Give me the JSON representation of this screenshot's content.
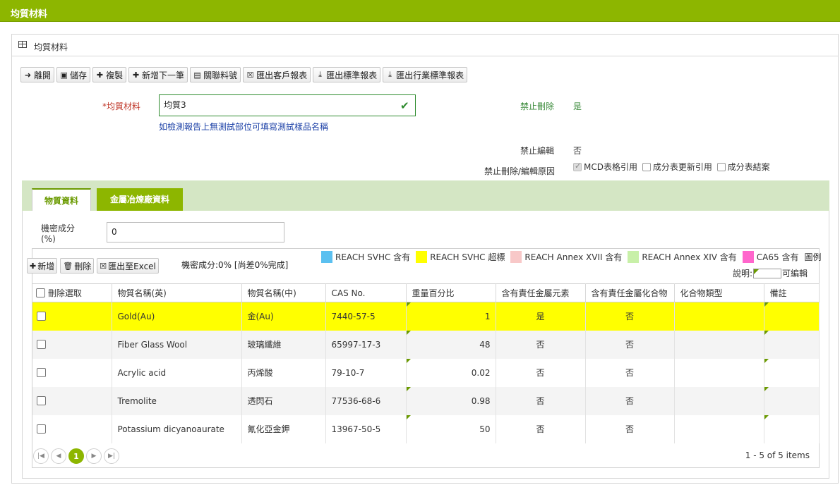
{
  "header": {
    "title": "均質材料"
  },
  "panel": {
    "title": "均質材料"
  },
  "toolbar": {
    "leave": "離開",
    "save": "儲存",
    "copy": "複製",
    "add_next": "新增下一筆",
    "link_part": "關聯料號",
    "export_customer": "匯出客戶報表",
    "export_standard": "匯出標準報表",
    "export_industry": "匯出行業標準報表"
  },
  "form": {
    "required_mark": "*",
    "material_label": "均質材料",
    "material_value": "均質3",
    "hint": "如檢測報告上無測試部位可填寫測試樣品名稱",
    "no_delete_label": "禁止刪除",
    "no_delete_value": "是",
    "no_edit_label": "禁止編輯",
    "no_edit_value": "否",
    "reason_label": "禁止刪除/編輯原因",
    "reasons": [
      {
        "label": "MCD表格引用",
        "checked": true
      },
      {
        "label": "成分表更新引用",
        "checked": false
      },
      {
        "label": "成分表結案",
        "checked": false
      }
    ]
  },
  "tabs": [
    {
      "label": "物質資料",
      "active": true
    },
    {
      "label": "金屬冶煉廠資料",
      "active": false
    }
  ],
  "substance": {
    "secret_label_1": "機密成分",
    "secret_label_2": "(%)",
    "secret_value": "0",
    "add": "新增",
    "delete": "刪除",
    "export_excel": "匯出至Excel",
    "summary": "機密成分:0% [尚差0%完成]"
  },
  "legend": {
    "items": [
      {
        "label": "REACH SVHC 含有",
        "color": "#5bc0f0"
      },
      {
        "label": "REACH SVHC 超標",
        "color": "#ffff00"
      },
      {
        "label": "REACH Annex XVII 含有",
        "color": "#f8c8c8"
      },
      {
        "label": "REACH Annex XIV 含有",
        "color": "#c8f0a8"
      },
      {
        "label": "CA65 含有",
        "color": "#ff66cc"
      }
    ],
    "title": "圖例",
    "note_prefix": "說明:",
    "note_suffix": "可編輯"
  },
  "table": {
    "columns": [
      "刪除選取",
      "物質名稱(英)",
      "物質名稱(中)",
      "CAS No.",
      "重量百分比",
      "含有責任金屬元素",
      "含有責任金屬化合物",
      "化合物類型",
      "備註"
    ],
    "rows": [
      {
        "en": "Gold(Au)",
        "zh": "金(Au)",
        "cas": "7440-57-5",
        "weight": "1",
        "metal": "是",
        "compound": "否",
        "type": "",
        "note": "",
        "style": "hl"
      },
      {
        "en": "Fiber Glass Wool",
        "zh": "玻璃纖維",
        "cas": "65997-17-3",
        "weight": "48",
        "metal": "否",
        "compound": "否",
        "type": "",
        "note": "",
        "style": "alt"
      },
      {
        "en": "Acrylic acid",
        "zh": "丙烯酸",
        "cas": "79-10-7",
        "weight": "0.02",
        "metal": "否",
        "compound": "否",
        "type": "",
        "note": "",
        "style": "plain"
      },
      {
        "en": "Tremolite",
        "zh": "透閃石",
        "cas": "77536-68-6",
        "weight": "0.98",
        "metal": "否",
        "compound": "否",
        "type": "",
        "note": "",
        "style": "alt"
      },
      {
        "en": "Potassium dicyanoaurate",
        "zh": "氰化亞金鉀",
        "cas": "13967-50-5",
        "weight": "50",
        "metal": "否",
        "compound": "否",
        "type": "",
        "note": "",
        "style": "plain"
      }
    ]
  },
  "pager": {
    "current_page": "1",
    "items_info": "1 - 5 of 5 items"
  }
}
